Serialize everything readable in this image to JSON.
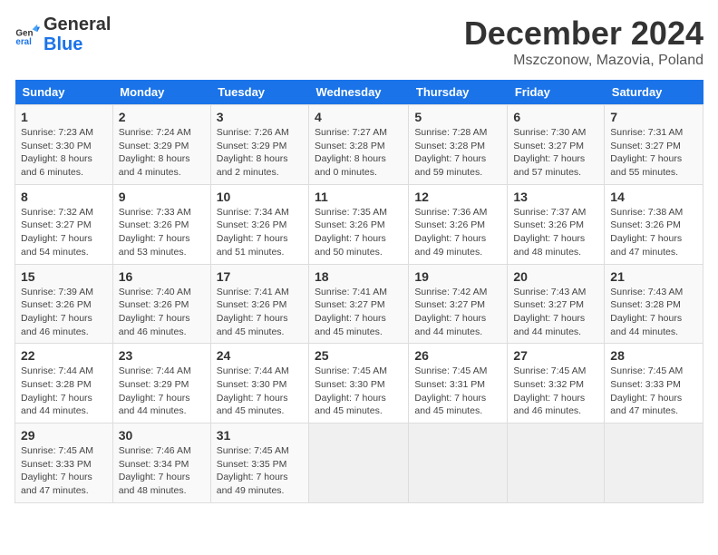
{
  "header": {
    "logo_line1": "General",
    "logo_line2": "Blue",
    "month": "December 2024",
    "location": "Mszczonow, Mazovia, Poland"
  },
  "days_of_week": [
    "Sunday",
    "Monday",
    "Tuesday",
    "Wednesday",
    "Thursday",
    "Friday",
    "Saturday"
  ],
  "weeks": [
    [
      {
        "day": "1",
        "info": "Sunrise: 7:23 AM\nSunset: 3:30 PM\nDaylight: 8 hours\nand 6 minutes."
      },
      {
        "day": "2",
        "info": "Sunrise: 7:24 AM\nSunset: 3:29 PM\nDaylight: 8 hours\nand 4 minutes."
      },
      {
        "day": "3",
        "info": "Sunrise: 7:26 AM\nSunset: 3:29 PM\nDaylight: 8 hours\nand 2 minutes."
      },
      {
        "day": "4",
        "info": "Sunrise: 7:27 AM\nSunset: 3:28 PM\nDaylight: 8 hours\nand 0 minutes."
      },
      {
        "day": "5",
        "info": "Sunrise: 7:28 AM\nSunset: 3:28 PM\nDaylight: 7 hours\nand 59 minutes."
      },
      {
        "day": "6",
        "info": "Sunrise: 7:30 AM\nSunset: 3:27 PM\nDaylight: 7 hours\nand 57 minutes."
      },
      {
        "day": "7",
        "info": "Sunrise: 7:31 AM\nSunset: 3:27 PM\nDaylight: 7 hours\nand 55 minutes."
      }
    ],
    [
      {
        "day": "8",
        "info": "Sunrise: 7:32 AM\nSunset: 3:27 PM\nDaylight: 7 hours\nand 54 minutes."
      },
      {
        "day": "9",
        "info": "Sunrise: 7:33 AM\nSunset: 3:26 PM\nDaylight: 7 hours\nand 53 minutes."
      },
      {
        "day": "10",
        "info": "Sunrise: 7:34 AM\nSunset: 3:26 PM\nDaylight: 7 hours\nand 51 minutes."
      },
      {
        "day": "11",
        "info": "Sunrise: 7:35 AM\nSunset: 3:26 PM\nDaylight: 7 hours\nand 50 minutes."
      },
      {
        "day": "12",
        "info": "Sunrise: 7:36 AM\nSunset: 3:26 PM\nDaylight: 7 hours\nand 49 minutes."
      },
      {
        "day": "13",
        "info": "Sunrise: 7:37 AM\nSunset: 3:26 PM\nDaylight: 7 hours\nand 48 minutes."
      },
      {
        "day": "14",
        "info": "Sunrise: 7:38 AM\nSunset: 3:26 PM\nDaylight: 7 hours\nand 47 minutes."
      }
    ],
    [
      {
        "day": "15",
        "info": "Sunrise: 7:39 AM\nSunset: 3:26 PM\nDaylight: 7 hours\nand 46 minutes."
      },
      {
        "day": "16",
        "info": "Sunrise: 7:40 AM\nSunset: 3:26 PM\nDaylight: 7 hours\nand 46 minutes."
      },
      {
        "day": "17",
        "info": "Sunrise: 7:41 AM\nSunset: 3:26 PM\nDaylight: 7 hours\nand 45 minutes."
      },
      {
        "day": "18",
        "info": "Sunrise: 7:41 AM\nSunset: 3:27 PM\nDaylight: 7 hours\nand 45 minutes."
      },
      {
        "day": "19",
        "info": "Sunrise: 7:42 AM\nSunset: 3:27 PM\nDaylight: 7 hours\nand 44 minutes."
      },
      {
        "day": "20",
        "info": "Sunrise: 7:43 AM\nSunset: 3:27 PM\nDaylight: 7 hours\nand 44 minutes."
      },
      {
        "day": "21",
        "info": "Sunrise: 7:43 AM\nSunset: 3:28 PM\nDaylight: 7 hours\nand 44 minutes."
      }
    ],
    [
      {
        "day": "22",
        "info": "Sunrise: 7:44 AM\nSunset: 3:28 PM\nDaylight: 7 hours\nand 44 minutes."
      },
      {
        "day": "23",
        "info": "Sunrise: 7:44 AM\nSunset: 3:29 PM\nDaylight: 7 hours\nand 44 minutes."
      },
      {
        "day": "24",
        "info": "Sunrise: 7:44 AM\nSunset: 3:30 PM\nDaylight: 7 hours\nand 45 minutes."
      },
      {
        "day": "25",
        "info": "Sunrise: 7:45 AM\nSunset: 3:30 PM\nDaylight: 7 hours\nand 45 minutes."
      },
      {
        "day": "26",
        "info": "Sunrise: 7:45 AM\nSunset: 3:31 PM\nDaylight: 7 hours\nand 45 minutes."
      },
      {
        "day": "27",
        "info": "Sunrise: 7:45 AM\nSunset: 3:32 PM\nDaylight: 7 hours\nand 46 minutes."
      },
      {
        "day": "28",
        "info": "Sunrise: 7:45 AM\nSunset: 3:33 PM\nDaylight: 7 hours\nand 47 minutes."
      }
    ],
    [
      {
        "day": "29",
        "info": "Sunrise: 7:45 AM\nSunset: 3:33 PM\nDaylight: 7 hours\nand 47 minutes."
      },
      {
        "day": "30",
        "info": "Sunrise: 7:46 AM\nSunset: 3:34 PM\nDaylight: 7 hours\nand 48 minutes."
      },
      {
        "day": "31",
        "info": "Sunrise: 7:45 AM\nSunset: 3:35 PM\nDaylight: 7 hours\nand 49 minutes."
      },
      {
        "day": "",
        "info": ""
      },
      {
        "day": "",
        "info": ""
      },
      {
        "day": "",
        "info": ""
      },
      {
        "day": "",
        "info": ""
      }
    ]
  ]
}
